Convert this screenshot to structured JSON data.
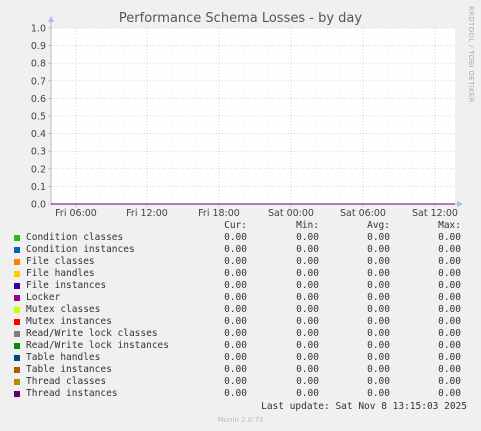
{
  "title": "Performance Schema Losses - by day",
  "side_label": "RRDTOOL / TOBI OETIKER",
  "columns": {
    "cur": "Cur:",
    "min": "Min:",
    "avg": "Avg:",
    "max": "Max:"
  },
  "chart_data": {
    "type": "line",
    "title": "Performance Schema Losses - by day",
    "xlabel": "",
    "ylabel": "",
    "x_ticks": [
      "Fri 06:00",
      "Fri 12:00",
      "Fri 18:00",
      "Sat 00:00",
      "Sat 06:00",
      "Sat 12:00"
    ],
    "y_ticks": [
      "0.0",
      "0.1",
      "0.2",
      "0.3",
      "0.4",
      "0.5",
      "0.6",
      "0.7",
      "0.8",
      "0.9",
      "1.0"
    ],
    "ylim": [
      0,
      1
    ],
    "grid": true,
    "series": [
      {
        "name": "Condition classes",
        "color": "#22bb22",
        "cur": "0.00",
        "min": "0.00",
        "avg": "0.00",
        "max": "0.00"
      },
      {
        "name": "Condition instances",
        "color": "#0066b3",
        "cur": "0.00",
        "min": "0.00",
        "avg": "0.00",
        "max": "0.00"
      },
      {
        "name": "File classes",
        "color": "#ff8000",
        "cur": "0.00",
        "min": "0.00",
        "avg": "0.00",
        "max": "0.00"
      },
      {
        "name": "File handles",
        "color": "#ffcc00",
        "cur": "0.00",
        "min": "0.00",
        "avg": "0.00",
        "max": "0.00"
      },
      {
        "name": "File instances",
        "color": "#330099",
        "cur": "0.00",
        "min": "0.00",
        "avg": "0.00",
        "max": "0.00"
      },
      {
        "name": "Locker",
        "color": "#990099",
        "cur": "0.00",
        "min": "0.00",
        "avg": "0.00",
        "max": "0.00"
      },
      {
        "name": "Mutex classes",
        "color": "#ccff00",
        "cur": "0.00",
        "min": "0.00",
        "avg": "0.00",
        "max": "0.00"
      },
      {
        "name": "Mutex instances",
        "color": "#ff0000",
        "cur": "0.00",
        "min": "0.00",
        "avg": "0.00",
        "max": "0.00"
      },
      {
        "name": "Read/Write lock classes",
        "color": "#808080",
        "cur": "0.00",
        "min": "0.00",
        "avg": "0.00",
        "max": "0.00"
      },
      {
        "name": "Read/Write lock instances",
        "color": "#008f00",
        "cur": "0.00",
        "min": "0.00",
        "avg": "0.00",
        "max": "0.00"
      },
      {
        "name": "Table handles",
        "color": "#00487d",
        "cur": "0.00",
        "min": "0.00",
        "avg": "0.00",
        "max": "0.00"
      },
      {
        "name": "Table instances",
        "color": "#b35a00",
        "cur": "0.00",
        "min": "0.00",
        "avg": "0.00",
        "max": "0.00"
      },
      {
        "name": "Thread classes",
        "color": "#b38f00",
        "cur": "0.00",
        "min": "0.00",
        "avg": "0.00",
        "max": "0.00"
      },
      {
        "name": "Thread instances",
        "color": "#6b006b",
        "cur": "0.00",
        "min": "0.00",
        "avg": "0.00",
        "max": "0.00"
      }
    ]
  },
  "last_update": "Last update: Sat Nov  8 13:15:03 2025",
  "munin_version": "Munin 2.0.73"
}
